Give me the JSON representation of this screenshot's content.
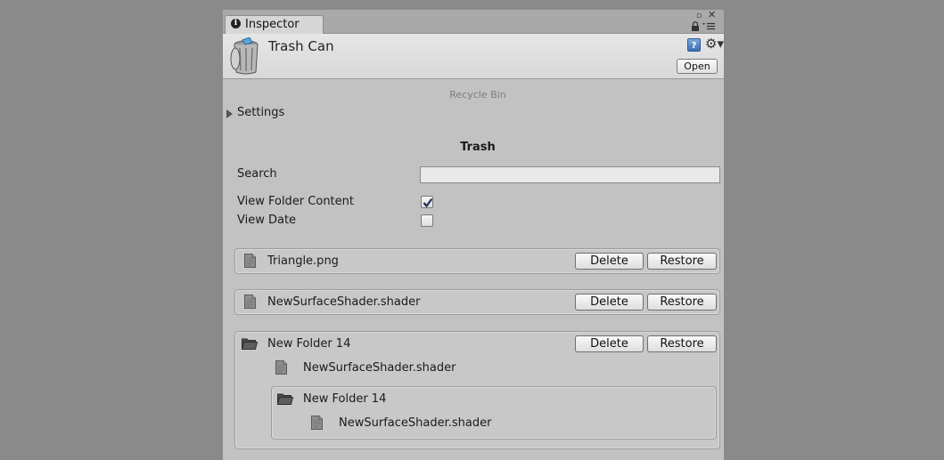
{
  "tab": {
    "label": "Inspector"
  },
  "window_controls": {
    "maximize": "▫",
    "close": "✕",
    "lock": "🔒",
    "menu": "▾≡"
  },
  "header": {
    "title": "Trash Can",
    "open_label": "Open",
    "help": "?",
    "gear": "⚙▾"
  },
  "subtitle": "Recycle Bin",
  "settings_foldout": {
    "label": "Settings",
    "expanded": false
  },
  "section_title": "Trash",
  "search": {
    "label": "Search",
    "value": "",
    "placeholder": ""
  },
  "options": {
    "view_folder_content": {
      "label": "View Folder Content",
      "checked": true
    },
    "view_date": {
      "label": "View Date",
      "checked": false
    }
  },
  "buttons": {
    "delete": "Delete",
    "restore": "Restore"
  },
  "items": [
    {
      "type": "file",
      "name": "Triangle.png"
    },
    {
      "type": "file",
      "name": "NewSurfaceShader.shader"
    },
    {
      "type": "folder",
      "name": "New Folder 14",
      "children": [
        {
          "type": "file",
          "name": "NewSurfaceShader.shader"
        },
        {
          "type": "folder",
          "name": "New Folder 14",
          "children": [
            {
              "type": "file",
              "name": "NewSurfaceShader.shader"
            }
          ]
        }
      ]
    }
  ],
  "colors": {
    "panel": "#c2c2c2",
    "background": "#8a8a8a",
    "header": "#e2e2e2"
  }
}
